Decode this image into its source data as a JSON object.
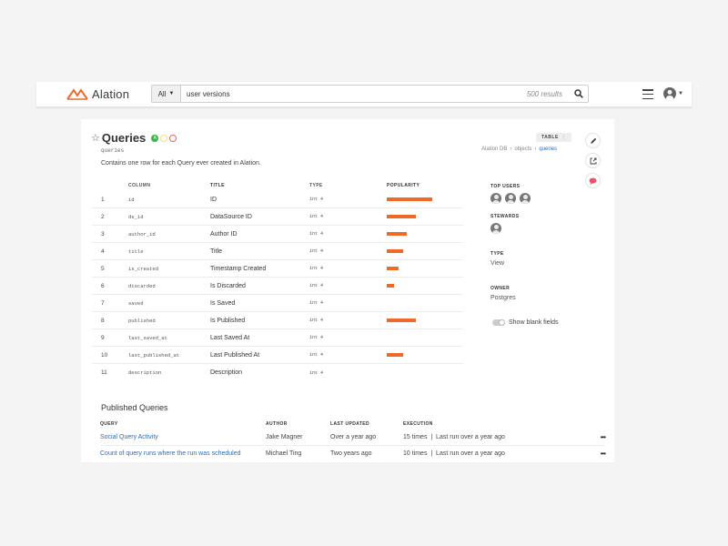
{
  "header": {
    "logo_text": "Alation",
    "search": {
      "scope": "All",
      "query": "user versions",
      "result_count": "500 results"
    }
  },
  "object": {
    "name": "Queries",
    "trust_badge": "A",
    "table_name": "queries",
    "description": "Contains one row for each Query ever created in Alation.",
    "type_badge": "TABLE",
    "breadcrumb": [
      "Alation DB",
      "objects",
      "queries"
    ]
  },
  "columns_table": {
    "headers": [
      "COLUMN",
      "TITLE",
      "TYPE",
      "POPULARITY"
    ],
    "rows": [
      {
        "num": "1",
        "column": "id",
        "title": "ID",
        "type": "int 4",
        "popularity": 0.63
      },
      {
        "num": "2",
        "column": "ds_id",
        "title": "DataSource ID",
        "type": "int 4",
        "popularity": 0.4
      },
      {
        "num": "3",
        "column": "author_id",
        "title": "Author ID",
        "type": "int 4",
        "popularity": 0.28
      },
      {
        "num": "4",
        "column": "title",
        "title": "Title",
        "type": "int 4",
        "popularity": 0.22
      },
      {
        "num": "5",
        "column": "is_created",
        "title": "Timestamp Created",
        "type": "int 4",
        "popularity": 0.16
      },
      {
        "num": "6",
        "column": "discarded",
        "title": "Is Discarded",
        "type": "int 4",
        "popularity": 0.1
      },
      {
        "num": "7",
        "column": "saved",
        "title": "Is Saved",
        "type": "int 4",
        "popularity": 0
      },
      {
        "num": "8",
        "column": "published",
        "title": "Is Published",
        "type": "int 4",
        "popularity": 0.4
      },
      {
        "num": "9",
        "column": "last_saved_at",
        "title": "Last Saved At",
        "type": "int 4",
        "popularity": 0
      },
      {
        "num": "10",
        "column": "last_published_at",
        "title": "Last Published At",
        "type": "int 4",
        "popularity": 0.22
      },
      {
        "num": "11",
        "column": "description",
        "title": "Description",
        "type": "int 4",
        "popularity": 0
      }
    ]
  },
  "info_panel": {
    "top_users_label": "TOP USERS",
    "stewards_label": "STEWARDS",
    "type_label": "TYPE",
    "type_value": "View",
    "owner_label": "OWNER",
    "owner_value": "Postgres",
    "toggle_label": "Show blank fields"
  },
  "published_queries": {
    "title": "Published Queries",
    "headers": [
      "QUERY",
      "AUTHOR",
      "LAST UPDATED",
      "EXECUTION"
    ],
    "rows": [
      {
        "query": "Social Query Activity",
        "author": "Jake Magner",
        "updated": "Over a year ago",
        "execution": "15 times  |  Last run over a year ago",
        "more": "•••"
      },
      {
        "query": "Count of query runs where the run was scheduled",
        "author": "Michael Ting",
        "updated": "Two years ago",
        "execution": "10 times  |  Last run over a year ago",
        "more": "•••"
      }
    ]
  },
  "colors": {
    "accent": "#ef6a2a",
    "link": "#2a6ebb",
    "trust_green": "#3cb54a"
  }
}
